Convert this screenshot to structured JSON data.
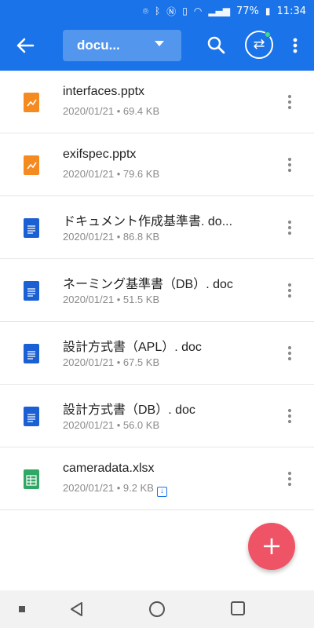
{
  "statusbar": {
    "battery": "77%",
    "time": "11:34"
  },
  "appbar": {
    "folder": "docu..."
  },
  "files": [
    {
      "name": "interfaces.pptx",
      "date": "2020/01/21",
      "size": "69.4 KB",
      "type": "pptx",
      "downloaded": false
    },
    {
      "name": "exifspec.pptx",
      "date": "2020/01/21",
      "size": "79.6 KB",
      "type": "pptx",
      "downloaded": false
    },
    {
      "name": "ドキュメント作成基準書. do...",
      "date": "2020/01/21",
      "size": "86.8 KB",
      "type": "doc",
      "downloaded": false
    },
    {
      "name": "ネーミング基準書（DB）. doc",
      "date": "2020/01/21",
      "size": "51.5 KB",
      "type": "doc",
      "downloaded": false
    },
    {
      "name": "設計方式書（APL）. doc",
      "date": "2020/01/21",
      "size": "67.5 KB",
      "type": "doc",
      "downloaded": false
    },
    {
      "name": "設計方式書（DB）. doc",
      "date": "2020/01/21",
      "size": "56.0 KB",
      "type": "doc",
      "downloaded": false
    },
    {
      "name": "cameradata.xlsx",
      "date": "2020/01/21",
      "size": "9.2 KB",
      "type": "xlsx",
      "downloaded": true
    }
  ],
  "colors": {
    "primary": "#1a73e8",
    "fab": "#ef5366",
    "pptx": "#f58a21",
    "doc": "#1a5fd4",
    "xlsx": "#2fa866"
  },
  "icons": {
    "back": "arrow-back-icon",
    "search": "search-icon",
    "sync": "sync-icon",
    "more": "more-vert-icon",
    "fab": "plus-icon"
  }
}
